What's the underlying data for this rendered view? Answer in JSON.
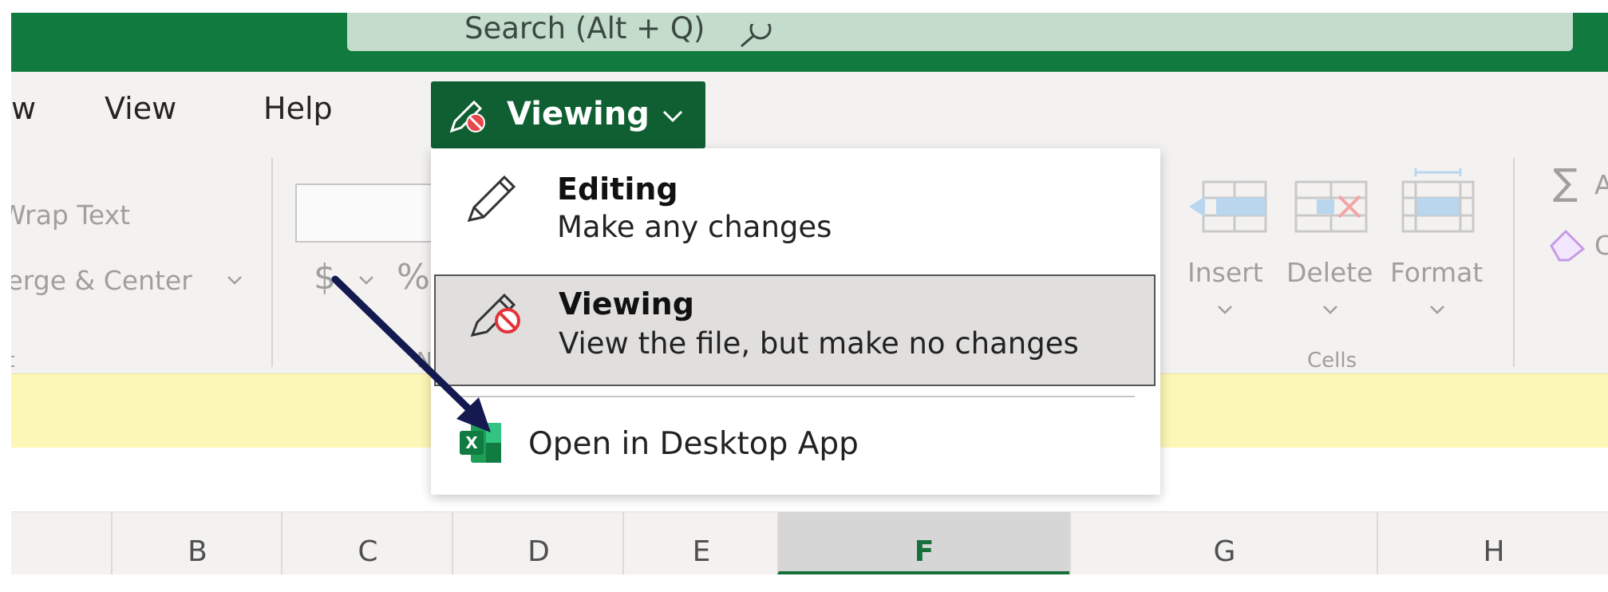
{
  "search": {
    "placeholder_text": "Search (Alt + Q)"
  },
  "menu": {
    "tabs": [
      {
        "label": "w"
      },
      {
        "label": "View"
      },
      {
        "label": "Help"
      }
    ],
    "mode_button": {
      "label": "Viewing"
    }
  },
  "ribbon": {
    "alignment": {
      "wrap_text": "Wrap Text",
      "merge_center": "Merge & Center",
      "group_label": "nt"
    },
    "number": {
      "currency": "$",
      "percent": "%",
      "group_label": "N"
    },
    "cells": {
      "insert": "Insert",
      "delete": "Delete",
      "format": "Format",
      "group_label": "Cells"
    },
    "editing": {
      "sum_letter": "A",
      "clear_letter": "C"
    }
  },
  "mode_dropdown": {
    "editing": {
      "title": "Editing",
      "description": "Make any changes"
    },
    "viewing": {
      "title": "Viewing",
      "description": "View the file, but make no changes"
    },
    "open_desktop": {
      "label": "Open in Desktop App"
    }
  },
  "grid": {
    "columns": [
      "B",
      "C",
      "D",
      "E",
      "F",
      "G",
      "H"
    ],
    "selected_column": "F"
  },
  "colors": {
    "brand_green": "#117a3f",
    "mode_button_bg": "#0f5f32",
    "selected_column_text": "#15703c",
    "arrow": "#141a4f",
    "notice_bar": "#fcf7b6"
  }
}
